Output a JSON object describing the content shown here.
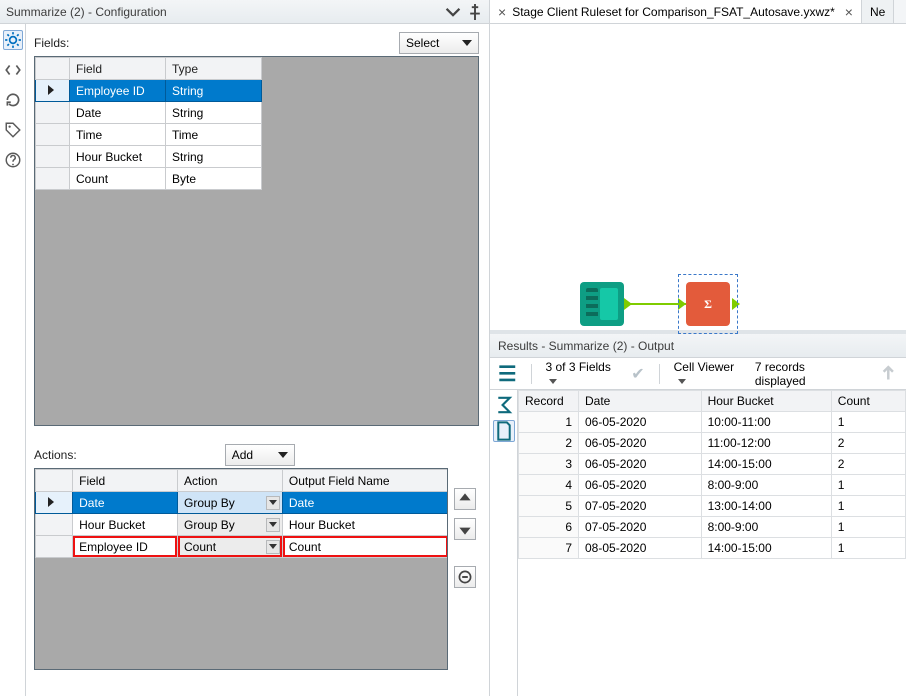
{
  "config": {
    "title": "Summarize (2) - Configuration",
    "fields_label": "Fields:",
    "select_btn": "Select",
    "fields_cols": {
      "field": "Field",
      "type": "Type"
    },
    "fields_rows": [
      {
        "field": "Employee ID",
        "type": "String",
        "selected": true
      },
      {
        "field": "Date",
        "type": "String"
      },
      {
        "field": "Time",
        "type": "Time"
      },
      {
        "field": "Hour Bucket",
        "type": "String"
      },
      {
        "field": "Count",
        "type": "Byte"
      }
    ],
    "actions_label": "Actions:",
    "add_btn": "Add",
    "actions_cols": {
      "field": "Field",
      "action": "Action",
      "out": "Output Field Name"
    },
    "actions_rows": [
      {
        "field": "Date",
        "action": "Group By",
        "out": "Date",
        "selected": true
      },
      {
        "field": "Hour Bucket",
        "action": "Group By",
        "out": "Hour Bucket"
      },
      {
        "field": "Employee ID",
        "action": "Count",
        "out": "Count",
        "highlight": true
      }
    ]
  },
  "tabs": {
    "active_label": "Stage Client Ruleset for Comparison_FSAT_Autosave.yxwz*",
    "inactive_label": "Ne"
  },
  "results": {
    "header": "Results - Summarize (2) - Output",
    "fields_count": "3 of 3 Fields",
    "cell_viewer": "Cell Viewer",
    "records_text": "7 records displayed",
    "cols": {
      "record": "Record",
      "date": "Date",
      "hb": "Hour Bucket",
      "count": "Count"
    },
    "rows": [
      {
        "r": "1",
        "date": "06-05-2020",
        "hb": "10:00-11:00",
        "count": "1"
      },
      {
        "r": "2",
        "date": "06-05-2020",
        "hb": "11:00-12:00",
        "count": "2"
      },
      {
        "r": "3",
        "date": "06-05-2020",
        "hb": "14:00-15:00",
        "count": "2"
      },
      {
        "r": "4",
        "date": "06-05-2020",
        "hb": "8:00-9:00",
        "count": "1"
      },
      {
        "r": "5",
        "date": "07-05-2020",
        "hb": "13:00-14:00",
        "count": "1"
      },
      {
        "r": "6",
        "date": "07-05-2020",
        "hb": "8:00-9:00",
        "count": "1"
      },
      {
        "r": "7",
        "date": "08-05-2020",
        "hb": "14:00-15:00",
        "count": "1"
      }
    ]
  }
}
